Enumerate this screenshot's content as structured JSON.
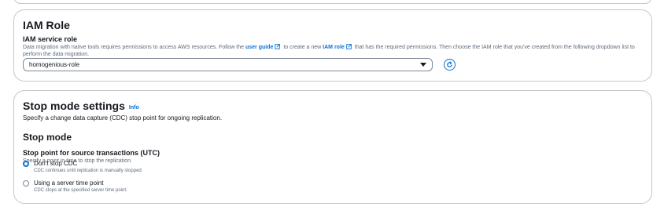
{
  "iam": {
    "title": "IAM Role",
    "field_label": "IAM service role",
    "desc_part1": "Data migration with native tools requires permissions to access AWS resources. Follow the",
    "link1": "user guide",
    "desc_part2": "to create a new",
    "link2": "IAM role",
    "desc_part3": "that has the required permissions. Then choose the IAM role that you've created from the following dropdown list to perform the data migration.",
    "selected_value": "homogenious-role"
  },
  "stop": {
    "title": "Stop mode settings",
    "info": "Info",
    "subtitle": "Specify a change data capture (CDC) stop point for ongoing replication.",
    "mode_heading": "Stop mode",
    "field_label": "Stop point for source transactions (UTC)",
    "field_desc": "Specify a point in time to stop the replication.",
    "options": [
      {
        "label": "Don't stop CDC",
        "desc": "CDC continues until replication is manually stopped.",
        "selected": true
      },
      {
        "label": "Using a server time point",
        "desc": "CDC stops at the specified server time point.",
        "selected": false
      }
    ]
  },
  "colors": {
    "accent": "#0972d3",
    "border": "#c6c6cd",
    "text": "#16191f",
    "muted": "#5f6b7a"
  }
}
